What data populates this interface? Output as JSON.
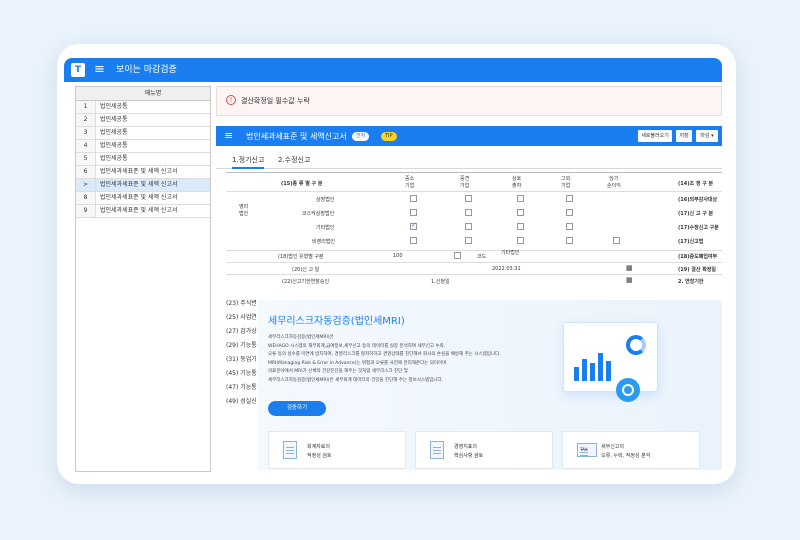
{
  "app": {
    "logo": "T",
    "title": "보이는 마감검증"
  },
  "sidebar": {
    "header": "메뉴명",
    "items": [
      {
        "num": "1",
        "label": "법인세공통"
      },
      {
        "num": "2",
        "label": "법인세공통"
      },
      {
        "num": "3",
        "label": "법인세공통"
      },
      {
        "num": "4",
        "label": "법인세공통"
      },
      {
        "num": "5",
        "label": "법인세공통"
      },
      {
        "num": "6",
        "label": "법인세과세표준 및 세액 신고서"
      },
      {
        "num": ">",
        "label": "법인세과세표준 및 세액 신고서"
      },
      {
        "num": "8",
        "label": "법인세과세표준 및 세액 신고서"
      },
      {
        "num": "9",
        "label": "법인세과세표준 및 세액 신고서"
      }
    ],
    "active_index": 6
  },
  "alert": {
    "text": "결산확정일 필수값 누락"
  },
  "form": {
    "title": "법인세과세표준 및 세액신고서",
    "badge_a": "전자",
    "badge_b": "TIP",
    "buttons": [
      "새로불러오기",
      "저장",
      "마감"
    ],
    "tabs": [
      "1.정기신고",
      "2.수정신고"
    ]
  },
  "grid": {
    "col_header_label": "(15)종 류 별 구 분",
    "columns": [
      "중소\n기업",
      "중견\n기업",
      "상호\n출자",
      "그외\n기업",
      "당기\n순이익"
    ],
    "right_header": "(14)조 정 구 분",
    "group_label": "영리\n법인",
    "rows": [
      "상장법인",
      "코스닥상장법인",
      "기타법인",
      "비영리법인"
    ],
    "right_labels": [
      "(16)외부감사대상",
      "(17)신 고 구 분",
      "(17)수정신고 구분",
      "(17)신고법"
    ],
    "checked_row": 2,
    "fields": {
      "row18_label": "(18)법인 유형별 구분",
      "row18_value": "100",
      "row18_code_label": "코드",
      "row18_code_value": "기타법인",
      "row18_right": "(18)중도폐업여부",
      "row20_label": "(20)신 고 일",
      "row20_value": "2022.03.31",
      "row20_right": "(19) 결산 확정일",
      "row22_label": "(22)신고기한연장승인",
      "row22_value": "1.신청일",
      "row22_right": "2. 연장기한"
    }
  },
  "lower_labels": [
    "(23) 주식변",
    "(25) 사업연",
    "(27) 감가상",
    "(29) 기능통",
    "(31) 동업기",
    "(45) 기능통",
    "(47) 기능통",
    "(49) 성실신"
  ],
  "promo": {
    "title": "세무리스크자동검증(법인세MRI)",
    "desc": [
      "세무리스크자동검증(법인세MRI)은",
      "WEHAGO 시스템의 재무회계,급여정보,세무신고 등의 데이터를 실증 분석하여 세무신고 누락,",
      "오류 등의 실수를 미연에 방지하여, 경영리스크를 철저히하고 경영상태를 진단해서 회사의 손실을 예방해 주는 시스템입니다.",
      "MRI(Managing Risk & Error in Advance)는 위험과 오류를 사전에 관리해준다는 의미이며",
      "의료분야에서 MRI가 신체의 건강진단을 해주는 것처럼 세무리스크 진단 및",
      "세무리스크자동검증(법인세MRI)은 세무회계 데이터의 건강을 진단해 주는 정보시스템입니다."
    ],
    "button": "검증하기",
    "cards": [
      {
        "line1": "회계자료의",
        "line2": "적정성 검토"
      },
      {
        "line1": "경영지표의",
        "line2": "핵심사항 검토"
      },
      {
        "line1": "세무신고의",
        "line2": "오류, 누락, 적정성 분석",
        "icon_text": "TAX"
      }
    ]
  },
  "colors": {
    "primary": "#1b7ef0",
    "alert_red": "#e04848",
    "badge_yellow": "#ffd41c",
    "background": "#eaf3fb"
  }
}
